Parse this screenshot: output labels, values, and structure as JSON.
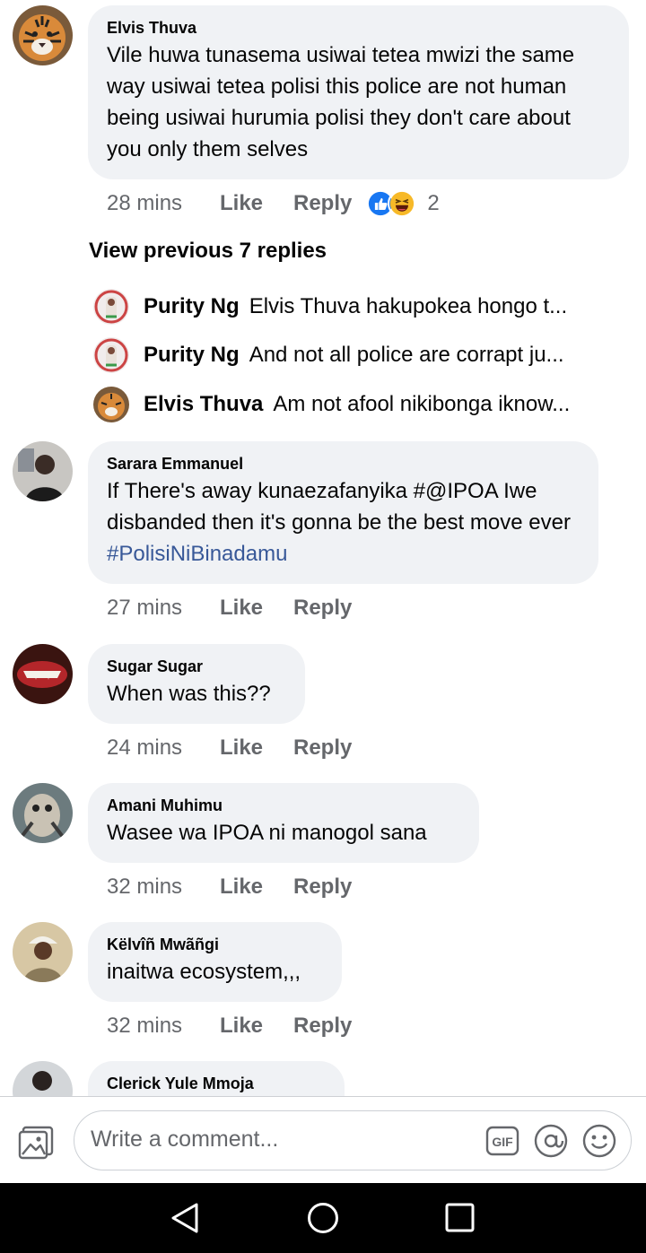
{
  "comments": [
    {
      "author": "Elvis Thuva",
      "text": "Vile huwa tunasema usiwai tetea mwizi the same way usiwai tetea polisi this police are not human being usiwai hurumia polisi they don't care about you only them selves",
      "time": "28 mins",
      "like_label": "Like",
      "reply_label": "Reply",
      "reaction_count": "2",
      "reactions": [
        "like-icon",
        "haha-icon"
      ]
    },
    {
      "author": "Sarara Emmanuel",
      "text": "If There's away kunaezafanyika #@IPOA Iwe disbanded then it's gonna be the best move ever",
      "hashtag": "#PolisiNiBinadamu",
      "time": "27 mins",
      "like_label": "Like",
      "reply_label": "Reply"
    },
    {
      "author": "Sugar Sugar",
      "text": "When was this??",
      "time": "24 mins",
      "like_label": "Like",
      "reply_label": "Reply"
    },
    {
      "author": "Amani Muhimu",
      "text": "Wasee wa IPOA ni manogol sana",
      "time": "32 mins",
      "like_label": "Like",
      "reply_label": "Reply"
    },
    {
      "author": "Këlvîñ Mwãñgi",
      "text": "inaitwa ecosystem,,,",
      "time": "32 mins",
      "like_label": "Like",
      "reply_label": "Reply"
    },
    {
      "author": "Clerick Yule Mmoja"
    }
  ],
  "replies_section": {
    "view_previous": "View previous 7 replies",
    "items": [
      {
        "author": "Purity Ng",
        "text": "Elvis Thuva hakupokea hongo t..."
      },
      {
        "author": "Purity Ng",
        "text": "And not all police are corrapt ju..."
      },
      {
        "author": "Elvis Thuva",
        "text": "Am not afool nikibonga iknow..."
      }
    ]
  },
  "composer": {
    "placeholder": "Write a comment...",
    "gif_label": "GIF"
  },
  "colors": {
    "bubble": "#f0f2f5",
    "secondary_text": "#65676b",
    "hashtag": "#385898",
    "like_blue": "#1877f2",
    "haha_yellow": "#f7b928"
  }
}
